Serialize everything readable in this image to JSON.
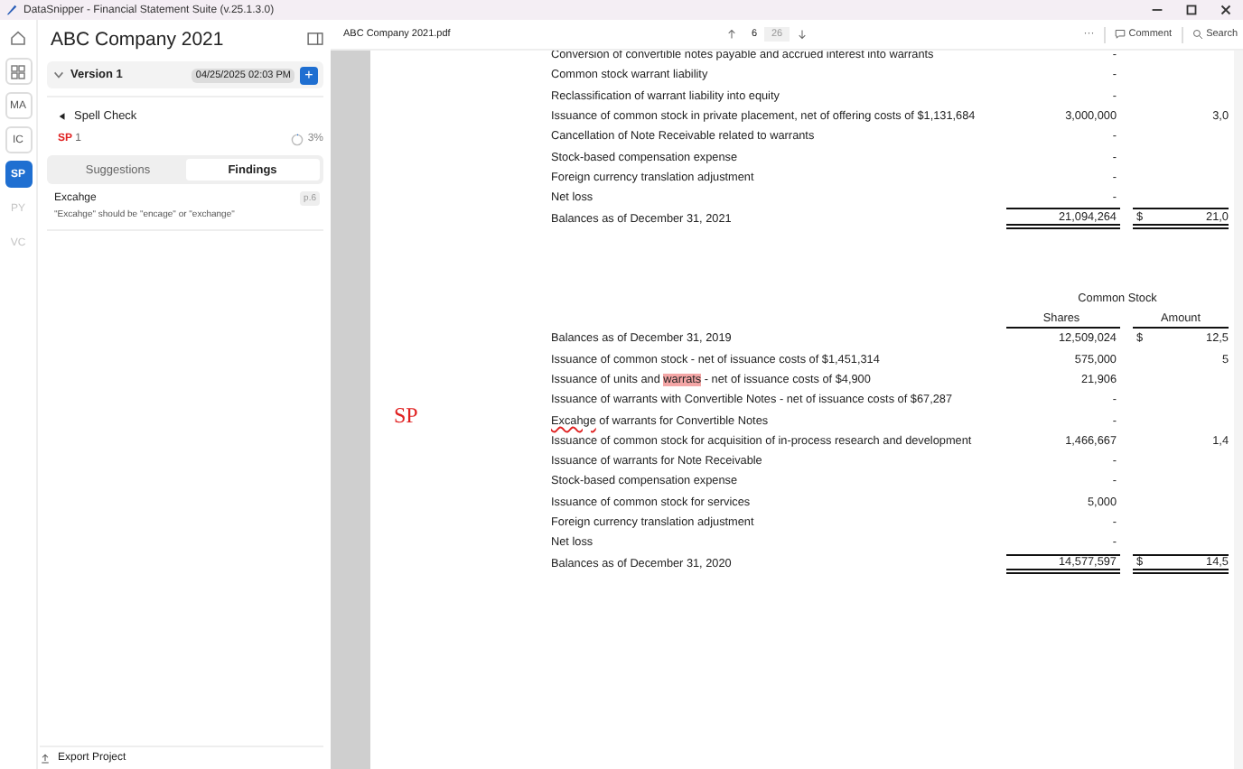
{
  "window": {
    "title": "DataSnipper - Financial Statement Suite (v.25.1.3.0)"
  },
  "rail": [
    {
      "kind": "home",
      "selected": false
    },
    {
      "kind": "grid",
      "selected": false
    },
    {
      "kind": "text",
      "label": "MA",
      "selected": false,
      "disabled": false
    },
    {
      "kind": "text",
      "label": "IC",
      "selected": false,
      "disabled": false
    },
    {
      "kind": "text",
      "label": "SP",
      "selected": true,
      "disabled": false
    },
    {
      "kind": "text",
      "label": "PY",
      "selected": false,
      "disabled": true
    },
    {
      "kind": "text",
      "label": "VC",
      "selected": false,
      "disabled": true
    }
  ],
  "panel": {
    "title": "ABC Company 2021",
    "version": {
      "label": "Version 1",
      "expanded": true,
      "date": "04/25/2025 02:03 PM",
      "add": "+"
    },
    "check": {
      "title": "Spell Check",
      "code": "SP",
      "count": "1",
      "progress": "3%",
      "level": 0.03,
      "tabs": [
        {
          "label": "Suggestions",
          "selected": false
        },
        {
          "label": "Findings",
          "selected": true
        }
      ],
      "findings": [
        {
          "word": "Excahge",
          "page": "p.6",
          "note": "\"Excahge\" should be \"encage\" or \"exchange\""
        }
      ]
    },
    "export": "Export Project"
  },
  "viewer": {
    "file": "ABC Company 2021.pdf",
    "page": "6",
    "pages": "26",
    "more": "···",
    "comment": "Comment",
    "search": "Search",
    "annotation": "SP",
    "table_top": [
      {
        "kind": "row",
        "parts": [
          {
            "kind": "plain",
            "text": "Conversion of convertible notes payable and accrued interest into warrants"
          }
        ],
        "shares": "-"
      },
      {
        "kind": "row",
        "parts": [
          {
            "kind": "plain",
            "text": "Common stock warrant liability"
          }
        ],
        "shares": "-"
      },
      {
        "kind": "row",
        "parts": [
          {
            "kind": "plain",
            "text": "Reclassification of warrant liability into equity"
          }
        ],
        "shares": "-"
      },
      {
        "kind": "row",
        "parts": [
          {
            "kind": "plain",
            "text": "Issuance of common stock in private placement, net of offering costs of $1,131,684"
          }
        ],
        "shares": "3,000,000",
        "amount": "3,0"
      },
      {
        "kind": "row",
        "parts": [
          {
            "kind": "plain",
            "text": "Cancellation of Note Receivable related to warrants"
          }
        ],
        "shares": "-"
      },
      {
        "kind": "row",
        "parts": [
          {
            "kind": "plain",
            "text": "Stock-based compensation expense"
          }
        ],
        "shares": "-"
      },
      {
        "kind": "row",
        "parts": [
          {
            "kind": "plain",
            "text": "Foreign currency translation adjustment"
          }
        ],
        "shares": "-"
      },
      {
        "kind": "row",
        "parts": [
          {
            "kind": "plain",
            "text": "Net loss"
          }
        ],
        "shares": "-"
      },
      {
        "kind": "total",
        "parts": [
          {
            "kind": "plain",
            "text": "Balances as of December 31, 2021"
          }
        ],
        "shares": "21,094,264",
        "dollar": "$",
        "amount": "21,0"
      }
    ],
    "group_header": "Common Stock",
    "columns": [
      "Shares",
      "Amount"
    ],
    "table_bottom": [
      {
        "kind": "row",
        "parts": [
          {
            "kind": "plain",
            "text": "Balances as of December 31, 2019"
          }
        ],
        "shares": "12,509,024",
        "dollar": "$",
        "amount": "12,5"
      },
      {
        "kind": "row",
        "parts": [
          {
            "kind": "plain",
            "text": "Issuance of common stock - net of issuance costs of $1,451,314"
          }
        ],
        "shares": "575,000",
        "amount": "5"
      },
      {
        "kind": "row",
        "parts": [
          {
            "kind": "plain",
            "text": "Issuance of units and "
          },
          {
            "kind": "highlight",
            "text": "warrats"
          },
          {
            "kind": "plain",
            "text": " - net of issuance costs of $4,900"
          }
        ],
        "shares": "21,906"
      },
      {
        "kind": "row",
        "parts": [
          {
            "kind": "plain",
            "text": "Issuance of warrants with Convertible Notes - net of issuance costs of $67,287"
          }
        ],
        "shares": "-"
      },
      {
        "kind": "row",
        "parts": [
          {
            "kind": "squiggle",
            "text": "Excahge"
          },
          {
            "kind": "plain",
            "text": " of warrants for Convertible Notes"
          }
        ],
        "shares": "-"
      },
      {
        "kind": "row",
        "parts": [
          {
            "kind": "plain",
            "text": "Issuance of common stock for acquisition of in-process research and development"
          }
        ],
        "shares": "1,466,667",
        "amount": "1,4"
      },
      {
        "kind": "row",
        "parts": [
          {
            "kind": "plain",
            "text": "Issuance of warrants for Note Receivable"
          }
        ],
        "shares": "-"
      },
      {
        "kind": "row",
        "parts": [
          {
            "kind": "plain",
            "text": "Stock-based compensation expense"
          }
        ],
        "shares": "-"
      },
      {
        "kind": "row",
        "parts": [
          {
            "kind": "plain",
            "text": "Issuance of common stock for services"
          }
        ],
        "shares": "5,000"
      },
      {
        "kind": "row",
        "parts": [
          {
            "kind": "plain",
            "text": "Foreign currency translation adjustment"
          }
        ],
        "shares": "-"
      },
      {
        "kind": "row",
        "parts": [
          {
            "kind": "plain",
            "text": "Net loss"
          }
        ],
        "shares": "-"
      },
      {
        "kind": "total",
        "parts": [
          {
            "kind": "plain",
            "text": "Balances as of December 31, 2020"
          }
        ],
        "shares": "14,577,597",
        "dollar": "$",
        "amount": "14,5"
      }
    ]
  }
}
